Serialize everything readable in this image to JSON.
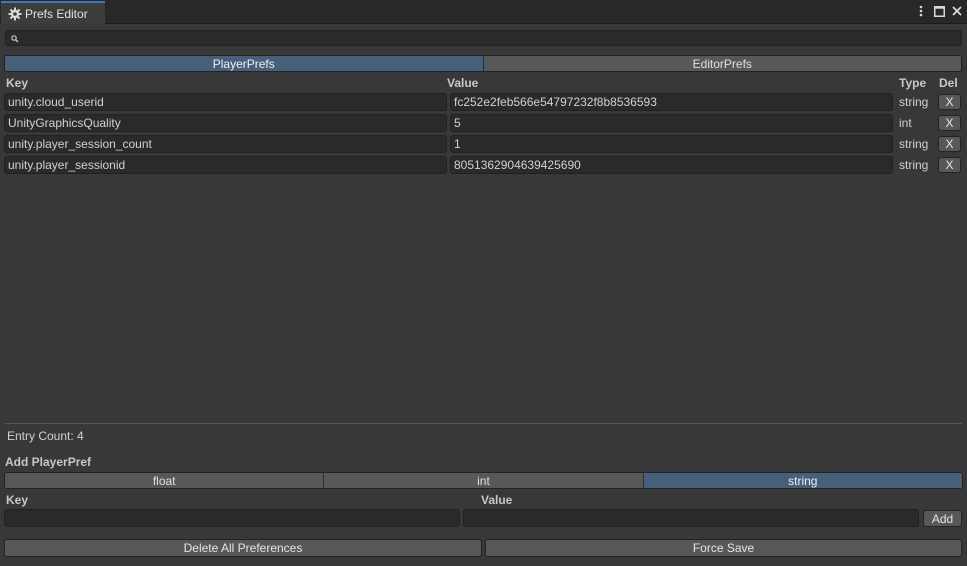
{
  "window": {
    "tab_title": "Prefs Editor",
    "icons": {
      "tab": "gear-icon",
      "menu": "kebab-menu-icon",
      "maximize": "maximize-icon",
      "close": "close-icon"
    }
  },
  "search": {
    "placeholder": "",
    "value": "",
    "icon": "search-icon"
  },
  "mode_tabs": [
    {
      "label": "PlayerPrefs",
      "active": true
    },
    {
      "label": "EditorPrefs",
      "active": false
    }
  ],
  "table": {
    "headers": {
      "key": "Key",
      "value": "Value",
      "type": "Type",
      "del": "Del"
    },
    "rows": [
      {
        "key": "unity.cloud_userid",
        "value": "fc252e2feb566e54797232f8b8536593",
        "type": "string",
        "del": "X"
      },
      {
        "key": "UnityGraphicsQuality",
        "value": "5",
        "type": "int",
        "del": "X"
      },
      {
        "key": "unity.player_session_count",
        "value": "1",
        "type": "string",
        "del": "X"
      },
      {
        "key": "unity.player_sessionid",
        "value": "8051362904639425690",
        "type": "string",
        "del": "X"
      }
    ]
  },
  "entry_count": "Entry Count: 4",
  "add_section": {
    "title": "Add PlayerPref",
    "types": [
      {
        "label": "float",
        "active": false
      },
      {
        "label": "int",
        "active": false
      },
      {
        "label": "string",
        "active": true
      }
    ],
    "key_label": "Key",
    "value_label": "Value",
    "key_value": "",
    "value_value": "",
    "add_label": "Add"
  },
  "footer": {
    "delete_all_label": "Delete All Preferences",
    "force_save_label": "Force Save"
  },
  "colors": {
    "accent": "#46607c",
    "tab_highlight": "#3a79bb",
    "background": "#383838"
  }
}
